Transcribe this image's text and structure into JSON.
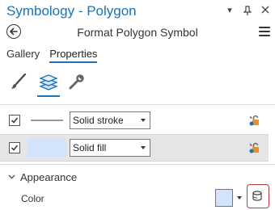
{
  "window": {
    "title": "Symbology - Polygon",
    "controls": {
      "options": "▾",
      "pin": "📌",
      "close": "✕"
    }
  },
  "header": {
    "title": "Format Polygon Symbol"
  },
  "tabs": [
    {
      "label": "Gallery",
      "active": false
    },
    {
      "label": "Properties",
      "active": true
    }
  ],
  "subtabs": [
    {
      "icon": "brush-icon",
      "active": false
    },
    {
      "icon": "layers-icon",
      "active": true
    },
    {
      "icon": "wrench-icon",
      "active": false
    }
  ],
  "layers": [
    {
      "checked": true,
      "type_label": "Solid stroke",
      "selected": false
    },
    {
      "checked": true,
      "type_label": "Solid fill",
      "selected": true
    }
  ],
  "appearance": {
    "section_label": "Appearance",
    "color_label": "Color",
    "color_value": "#d3e3fb"
  },
  "colors": {
    "accent": "#1a73b8",
    "fill": "#d3e3fb",
    "highlight_border": "#c23b3b"
  }
}
